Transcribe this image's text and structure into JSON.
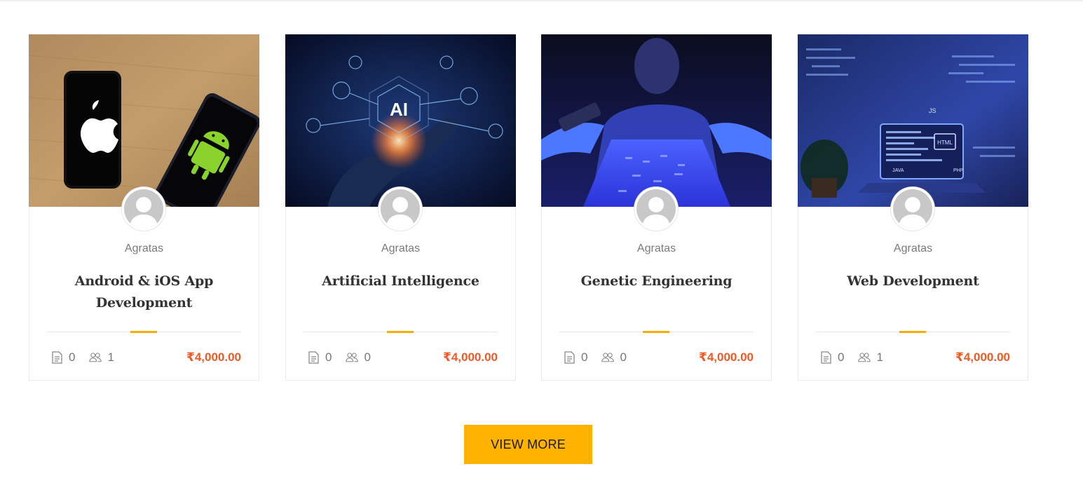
{
  "courses": [
    {
      "image": "android-ios-phones-photo",
      "author": "Agratas",
      "title": "Android & iOS App Development",
      "lessons": "0",
      "students": "1",
      "price": "₹4,000.00"
    },
    {
      "image": "artificial-intelligence-hand-photo",
      "author": "Agratas",
      "title": "Artificial Intelligence",
      "lessons": "0",
      "students": "0",
      "price": "₹4,000.00"
    },
    {
      "image": "genetic-engineering-lab-photo",
      "author": "Agratas",
      "title": "Genetic Engineering",
      "lessons": "0",
      "students": "0",
      "price": "₹4,000.00"
    },
    {
      "image": "web-development-laptop-photo",
      "author": "Agratas",
      "title": "Web Development",
      "lessons": "0",
      "students": "1",
      "price": "₹4,000.00"
    }
  ],
  "view_more_label": "VIEW MORE",
  "icons": {
    "lessons": "document-icon",
    "students": "users-icon",
    "avatar": "user-avatar-icon"
  },
  "colors": {
    "accent": "#f5ae00",
    "button": "#ffb300",
    "price": "#ef5a24"
  }
}
